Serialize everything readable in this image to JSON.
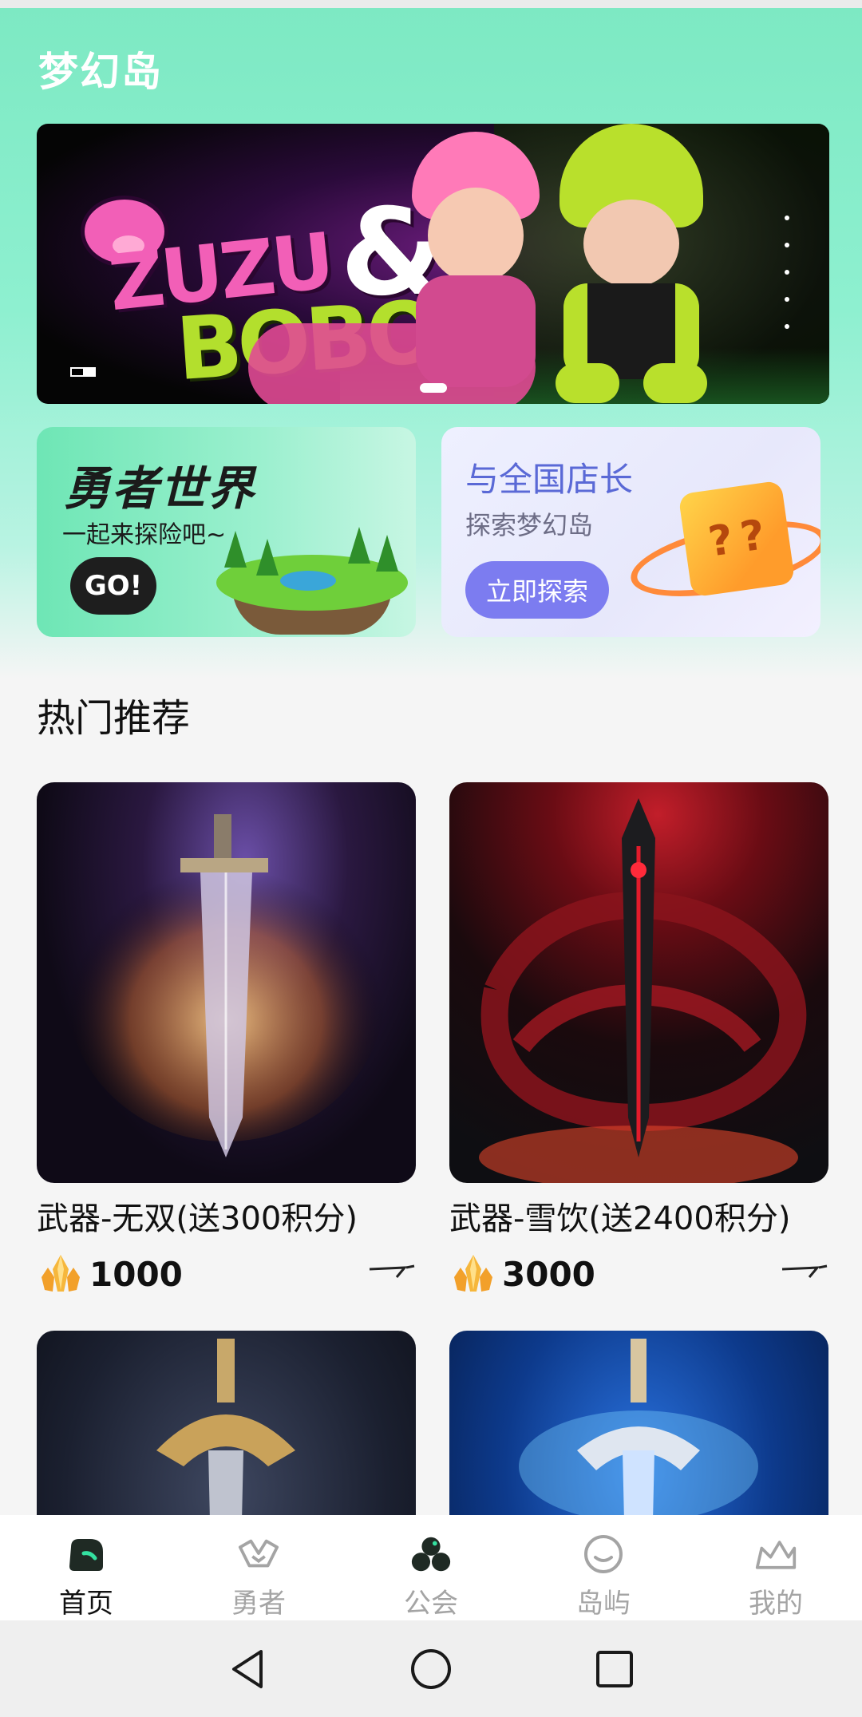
{
  "app": {
    "title": "梦幻岛"
  },
  "banner": {
    "logo_line1": "ZUZU",
    "logo_amp": "&",
    "logo_line2": "BOBO"
  },
  "promos": [
    {
      "title": "勇者世界",
      "subtitle": "一起来探险吧~",
      "button": "GO!"
    },
    {
      "title": "与全国店长",
      "subtitle": "探索梦幻岛",
      "button": "立即探索"
    }
  ],
  "section": {
    "title": "热门推荐"
  },
  "products": [
    {
      "title": "武器-无双(送300积分)",
      "price": "1000"
    },
    {
      "title": "武器-雪饮(送2400积分)",
      "price": "3000"
    }
  ],
  "nav": {
    "items": [
      {
        "label": "首页",
        "icon": "home-icon",
        "active": true
      },
      {
        "label": "勇者",
        "icon": "hero-icon",
        "active": false
      },
      {
        "label": "公会",
        "icon": "guild-icon",
        "active": false
      },
      {
        "label": "岛屿",
        "icon": "island-icon",
        "active": false
      },
      {
        "label": "我的",
        "icon": "profile-icon",
        "active": false
      }
    ]
  },
  "colors": {
    "accent_green": "#7de9c3",
    "explore_button": "#7c7cf0",
    "promo_right_title": "#5a69d6"
  }
}
